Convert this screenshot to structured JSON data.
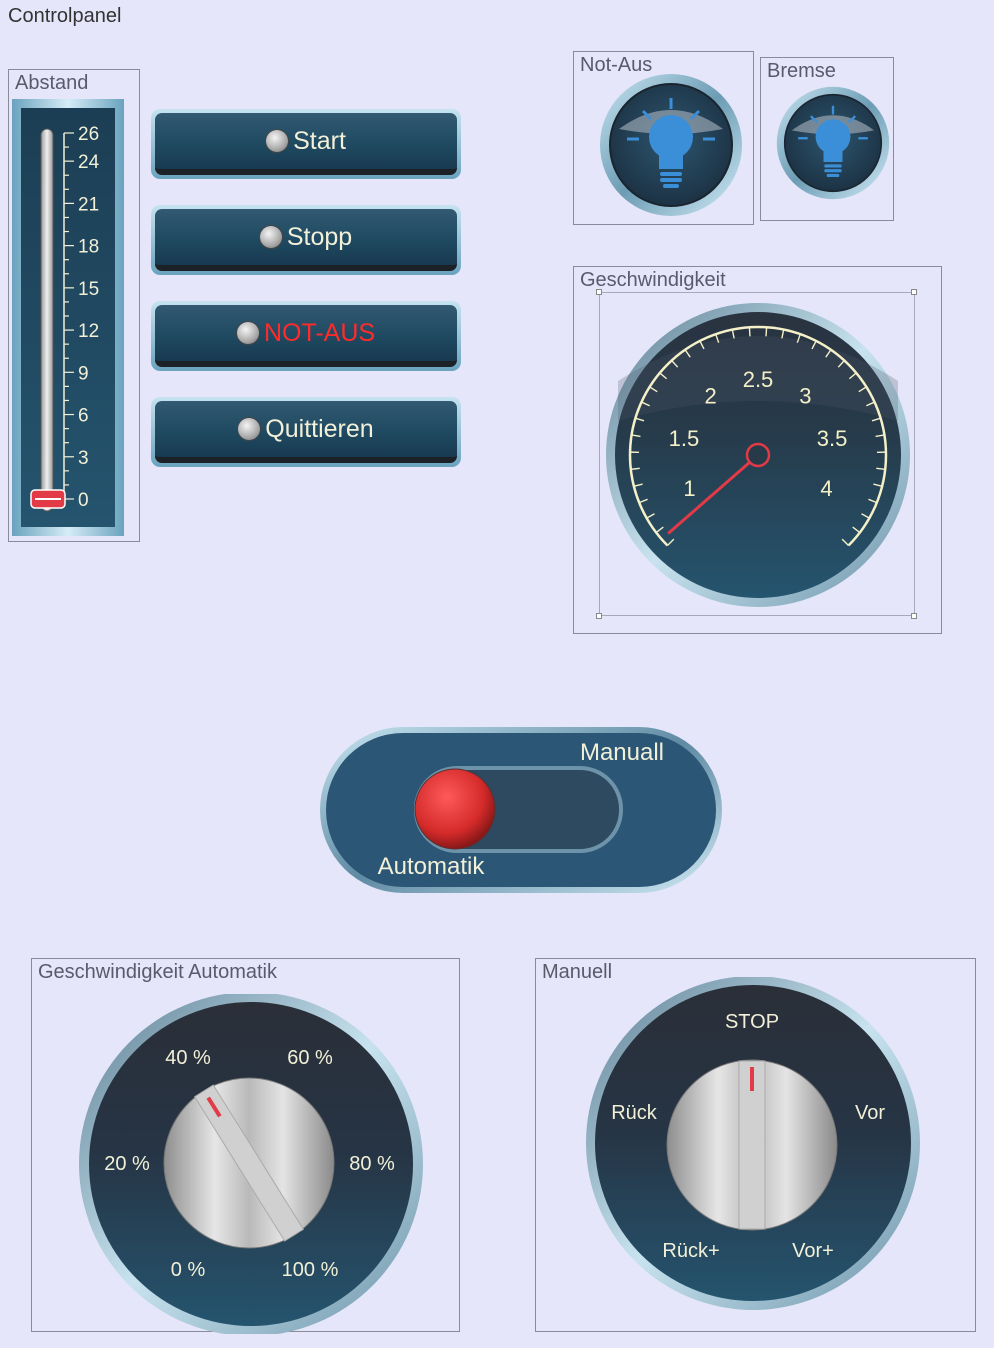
{
  "window": {
    "title": "Controlpanel"
  },
  "distance": {
    "title": "Abstand",
    "scale_labels": [
      "26",
      "24",
      "21",
      "18",
      "15",
      "12",
      "9",
      "6",
      "3",
      "0"
    ],
    "scale_values": [
      26,
      24,
      21,
      18,
      15,
      12,
      9,
      6,
      3,
      0
    ],
    "value": 0,
    "max": 26
  },
  "buttons": [
    {
      "label": "Start"
    },
    {
      "label": "Stopp"
    },
    {
      "label": "NOT-AUS",
      "color": "#ff2a2a"
    },
    {
      "label": "Quittieren"
    }
  ],
  "indicators": {
    "not_aus": {
      "title": "Not-Aus",
      "icon": "lightbulb-icon",
      "state": "off"
    },
    "bremse": {
      "title": "Bremse",
      "icon": "lightbulb-icon",
      "state": "off"
    }
  },
  "speed_gauge": {
    "title": "Geschwindigkeit",
    "labels": [
      "1",
      "1.5",
      "2",
      "2.5",
      "3",
      "3.5",
      "4"
    ],
    "min": 0.75,
    "max": 4.25,
    "value": 0.8
  },
  "mode_switch": {
    "label_on": "Manuall",
    "label_off": "Automatik",
    "state": "Automatik"
  },
  "auto_speed_knob": {
    "title": "Geschwindigkeit Automatik",
    "labels": [
      "0 %",
      "20 %",
      "40 %",
      "60 %",
      "80 %",
      "100 %"
    ],
    "selected": "40 %"
  },
  "manual_knob": {
    "title": "Manuell",
    "labels": [
      "STOP",
      "Rück",
      "Vor",
      "Rück+",
      "Vor+"
    ],
    "selected": "STOP"
  },
  "colors": {
    "background": "#e6e6fa",
    "panel_dark": "#1f4a62",
    "text_light": "#f2f0d8",
    "alarm_red": "#ff2a2a",
    "lamp_blue": "#3a8fd8"
  }
}
